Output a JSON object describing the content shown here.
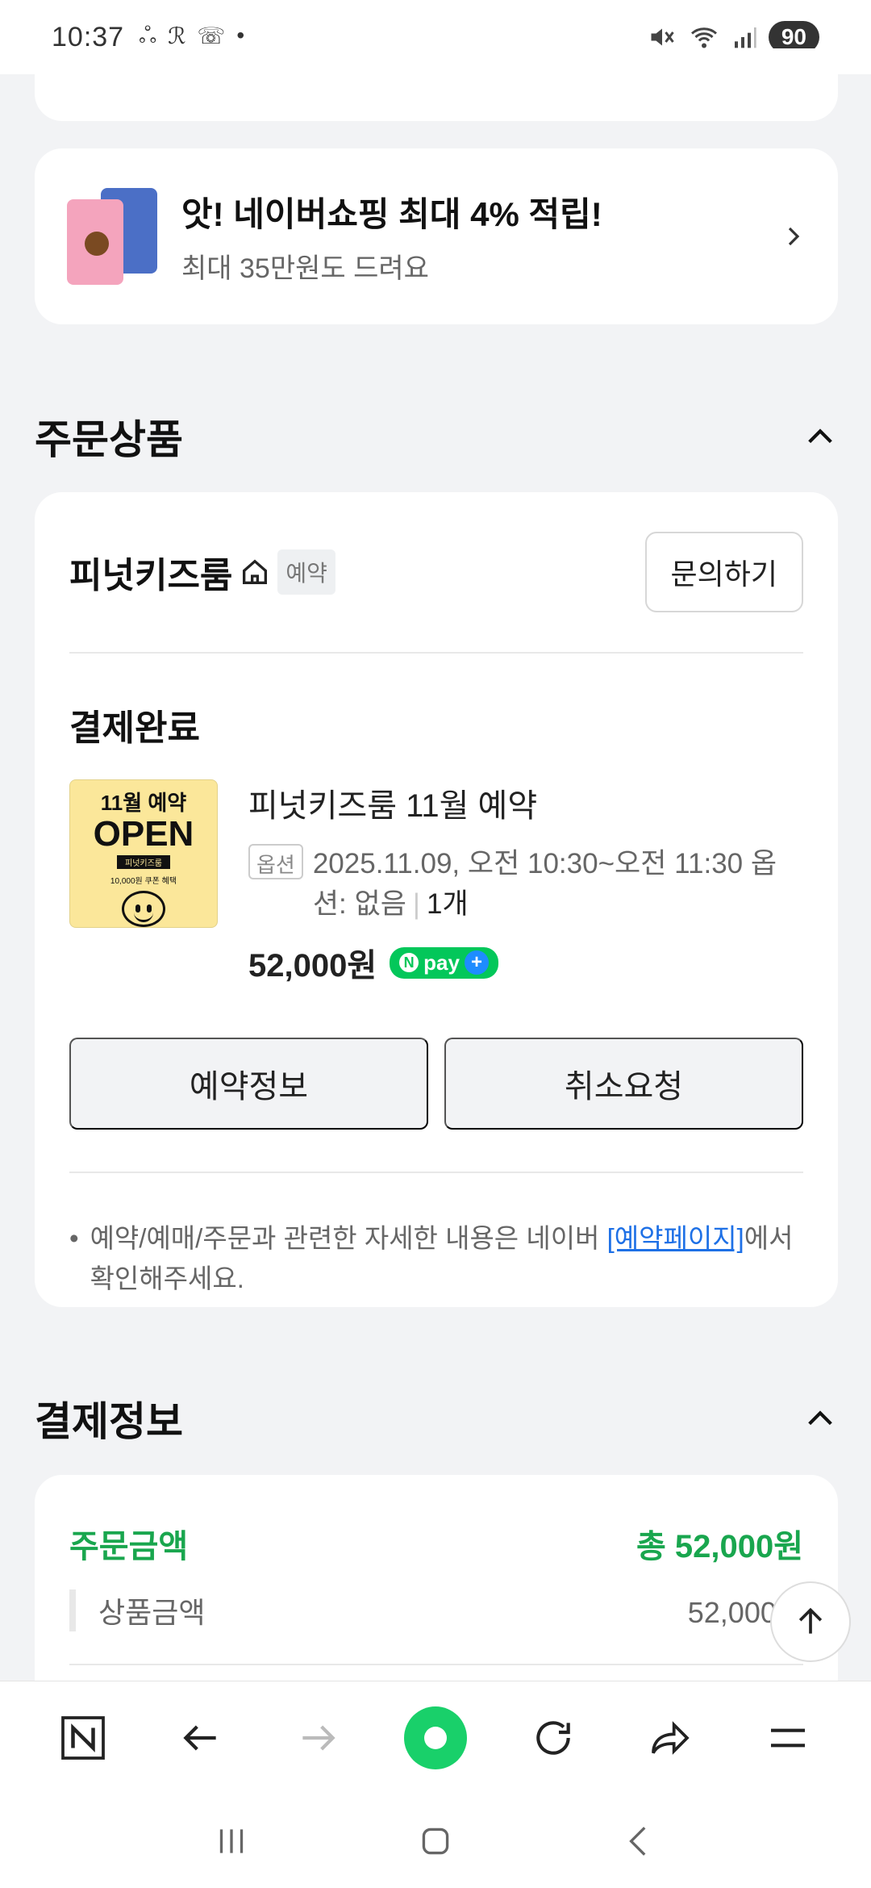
{
  "status_bar": {
    "time": "10:37",
    "battery": "90"
  },
  "promo": {
    "title": "앗! 네이버쇼핑 최대 4% 적립!",
    "subtitle": "최대 35만원도 드려요"
  },
  "order_section": {
    "title": "주문상품"
  },
  "store": {
    "name": "피넛키즈룸",
    "badge": "예약",
    "inquiry_label": "문의하기"
  },
  "order": {
    "status": "결제완료",
    "thumb": {
      "line1": "11월 예약",
      "line2": "OPEN",
      "line3": "피넛키즈룸",
      "line4": "10,000원 쿠폰 혜택"
    },
    "product_name": "피넛키즈룸 11월 예약",
    "option_tag": "옵션",
    "option_text": "2025.11.09, 오전 10:30~오전 11:30 옵션: 없음",
    "quantity": "1개",
    "price": "52,000원",
    "npay_label": "pay",
    "buttons": {
      "reserve_info": "예약정보",
      "cancel_request": "취소요청"
    },
    "notice": {
      "text_before": "예약/예매/주문과 관련한 자세한 내용은 네이버 ",
      "link": "[예약페이지]",
      "text_after": "에서 확인해주세요."
    }
  },
  "payment_section": {
    "title": "결제정보"
  },
  "payment": {
    "order_amount_label": "주문금액",
    "total": "총 52,000원",
    "product_amount_label": "상품금액",
    "product_amount": "52,000원"
  },
  "icons": {
    "nav": [
      "naver-n-icon",
      "back-arrow-icon",
      "forward-arrow-icon",
      "green-dot-icon",
      "refresh-icon",
      "share-icon",
      "menu-icon"
    ],
    "android": [
      "recent-apps-icon",
      "home-icon",
      "back-icon"
    ]
  },
  "colors": {
    "naver_green": "#03c75a",
    "link_blue": "#1e70e6",
    "payment_green": "#19a64e"
  }
}
